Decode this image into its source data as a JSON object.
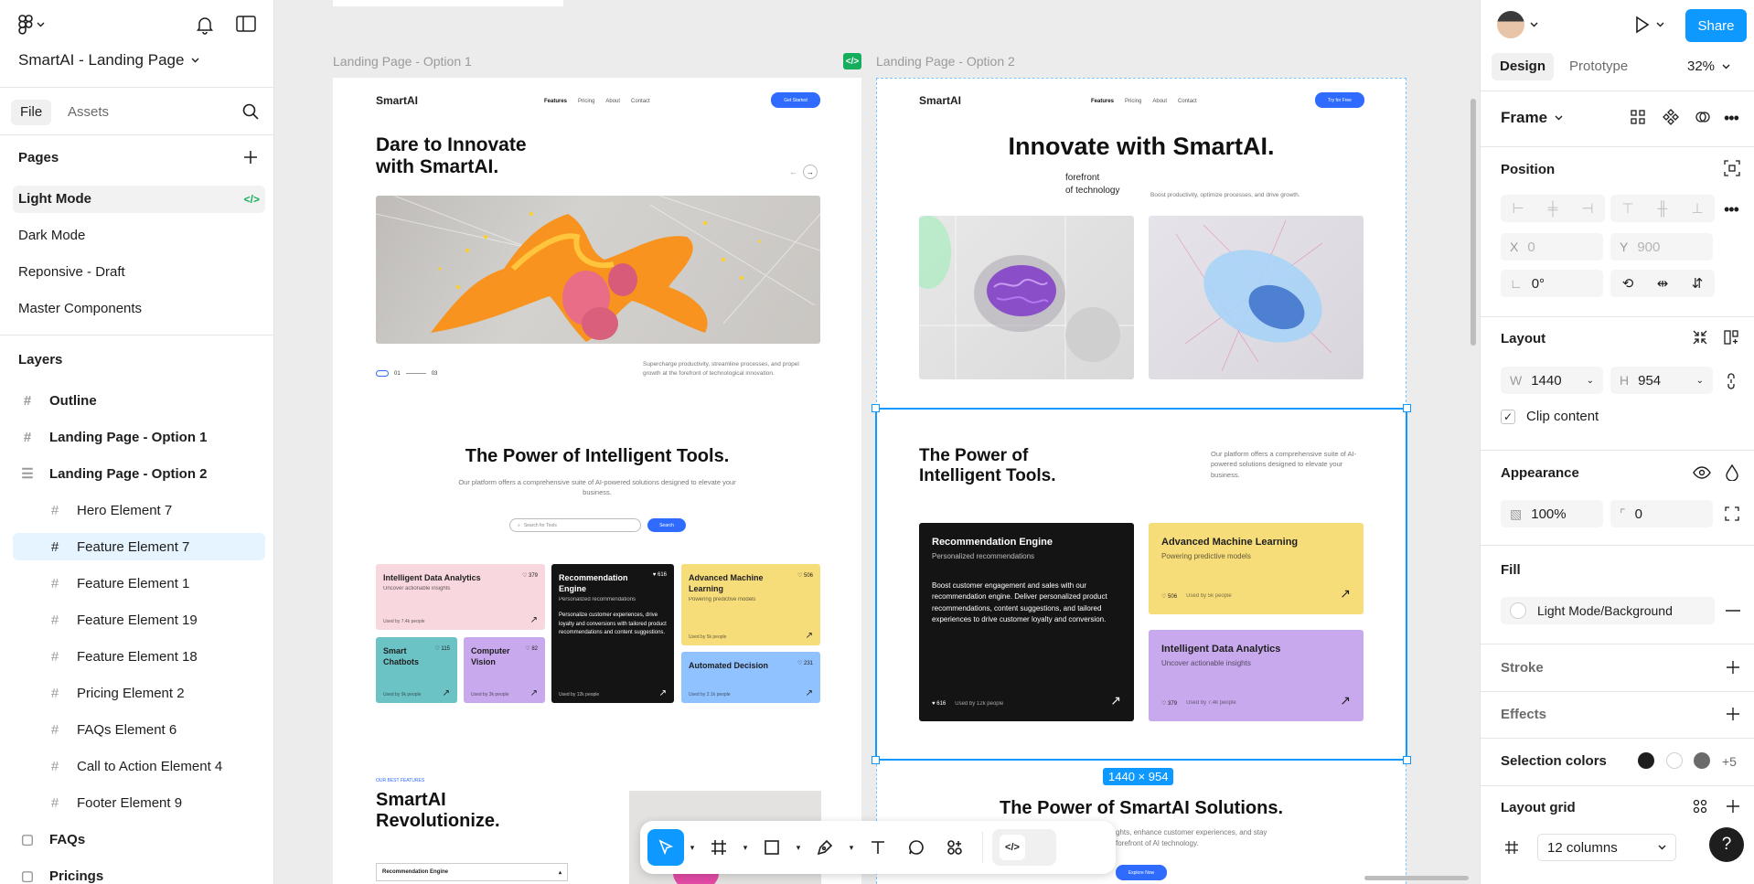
{
  "file": {
    "name": "SmartAI - Landing Page",
    "tab_file": "File",
    "tab_assets": "Assets"
  },
  "pages": {
    "header": "Pages",
    "items": [
      "Light Mode",
      "Dark Mode",
      "Reponsive - Draft",
      "Master Components"
    ],
    "active_code": "</>"
  },
  "layers": {
    "header": "Layers",
    "items": [
      {
        "label": "Outline",
        "bold": true
      },
      {
        "label": "Landing Page - Option 1",
        "bold": true
      },
      {
        "label": "Landing Page - Option 2",
        "bold": true
      },
      {
        "label": "Hero Element 7"
      },
      {
        "label": "Feature Element 7"
      },
      {
        "label": "Feature Element 1"
      },
      {
        "label": "Feature Element 19"
      },
      {
        "label": "Feature Element 18"
      },
      {
        "label": "Pricing Element 2"
      },
      {
        "label": "FAQs Element 6"
      },
      {
        "label": "Call to Action Element 4"
      },
      {
        "label": "Footer Element 9"
      },
      {
        "label": "FAQs",
        "bold": true
      },
      {
        "label": "Pricings",
        "bold": true
      }
    ]
  },
  "canvas": {
    "label1": "Landing Page - Option 1",
    "label2": "Landing Page - Option 2",
    "size_badge": "1440 × 954",
    "opt1": {
      "logo": "SmartAI",
      "nav": [
        "Features",
        "Pricing",
        "About",
        "Contact"
      ],
      "cta": "Get Started",
      "hero_title_1": "Dare to Innovate",
      "hero_title_2": "with SmartAI.",
      "slide_from": "01",
      "slide_to": "03",
      "hero_text": "Supercharge productivity, streamline processes, and propel growth at the forefront of technological innovation.",
      "tools_title": "The Power of Intelligent Tools.",
      "tools_text": "Our platform offers a comprehensive suite of AI-powered solutions designed to elevate your business.",
      "search_placeholder": "Search for Tools",
      "search_btn": "Search",
      "cards": {
        "c1": {
          "title": "Intelligent Data Analytics",
          "sub": "Uncover actionable insights",
          "likes": "379",
          "used": "Used by 7.4k people"
        },
        "c2": {
          "title": "Recommendation Engine",
          "sub": "Personalized recommendations",
          "likes": "616",
          "body": "Personalize customer experiences, drive loyalty and conversions with tailored product recommendations and content suggestions.",
          "used": "Used by 12k people"
        },
        "c3": {
          "title": "Advanced Machine Learning",
          "sub": "Powering predictive models",
          "likes": "506",
          "used": "Used by 5k people"
        },
        "c4": {
          "title": "Smart Chatbots",
          "likes": "115",
          "used": "Used by 9k people"
        },
        "c5": {
          "title": "Computer Vision",
          "likes": "82",
          "used": "Used by 3k people"
        },
        "c6": {
          "title": "Automated Decision",
          "likes": "231",
          "used": "Used by 2.1k people"
        }
      },
      "features_kicker": "OUR BEST FEATURES",
      "features_title_1": "SmartAI",
      "features_title_2": "Revolutionize.",
      "accordion": "Recommendation Engine"
    },
    "opt2": {
      "logo": "SmartAI",
      "nav": [
        "Features",
        "Pricing",
        "About",
        "Contact"
      ],
      "cta": "Try for Free",
      "hero_title": "Innovate with SmartAI.",
      "hero_sub_1": "forefront",
      "hero_sub_2": "of technology",
      "hero_text": "Boost productivity, optimize processes, and drive growth.",
      "tools_title_1": "The Power of",
      "tools_title_2": "Intelligent Tools.",
      "tools_text": "Our platform offers a comprehensive suite of AI-powered solutions designed to elevate your business.",
      "cards": {
        "c1": {
          "title": "Recommendation Engine",
          "sub": "Personalized recommendations",
          "body": "Boost customer engagement and sales with our recommendation engine. Deliver personalized product recommendations, content suggestions, and tailored experiences to drive customer loyalty and conversion.",
          "likes": "616",
          "used": "Used by 12k people"
        },
        "c2": {
          "title": "Advanced Machine Learning",
          "sub": "Powering predictive models",
          "likes": "506",
          "used": "Used by 5k people"
        },
        "c3": {
          "title": "Intelligent Data Analytics",
          "sub": "Uncover actionable insights",
          "likes": "379",
          "used": "Used by 7.4k people"
        }
      },
      "solutions_title": "The Power of SmartAI Solutions.",
      "solutions_text_1": "ghts, enhance customer experiences, and stay",
      "solutions_text_2": "forefront of AI technology.",
      "solutions_btn": "Explore Now"
    }
  },
  "right": {
    "share": "Share",
    "tab_design": "Design",
    "tab_prototype": "Prototype",
    "zoom": "32%",
    "frame_label": "Frame",
    "position": "Position",
    "x_label": "X",
    "x_value": "0",
    "y_label": "Y",
    "y_value": "900",
    "rotation": "0°",
    "layout": "Layout",
    "w_label": "W",
    "w_value": "1440",
    "h_label": "H",
    "h_value": "954",
    "clip": "Clip content",
    "appearance": "Appearance",
    "opacity": "100%",
    "radius": "0",
    "fill": "Fill",
    "fill_value": "Light Mode/Background",
    "stroke": "Stroke",
    "effects": "Effects",
    "selection_colors": "Selection colors",
    "more_colors": "+5",
    "layout_grid": "Layout grid",
    "grid_value": "12 columns",
    "help": "?"
  },
  "colors": {
    "accent": "#0d99ff",
    "brand_blue": "#2f6bff",
    "pink": "#f8d7df",
    "yellow": "#f7dd7a",
    "teal": "#6cc3c6",
    "purple": "#c8a9ee",
    "lightblue": "#8fc2ff",
    "dark": "#141414"
  }
}
